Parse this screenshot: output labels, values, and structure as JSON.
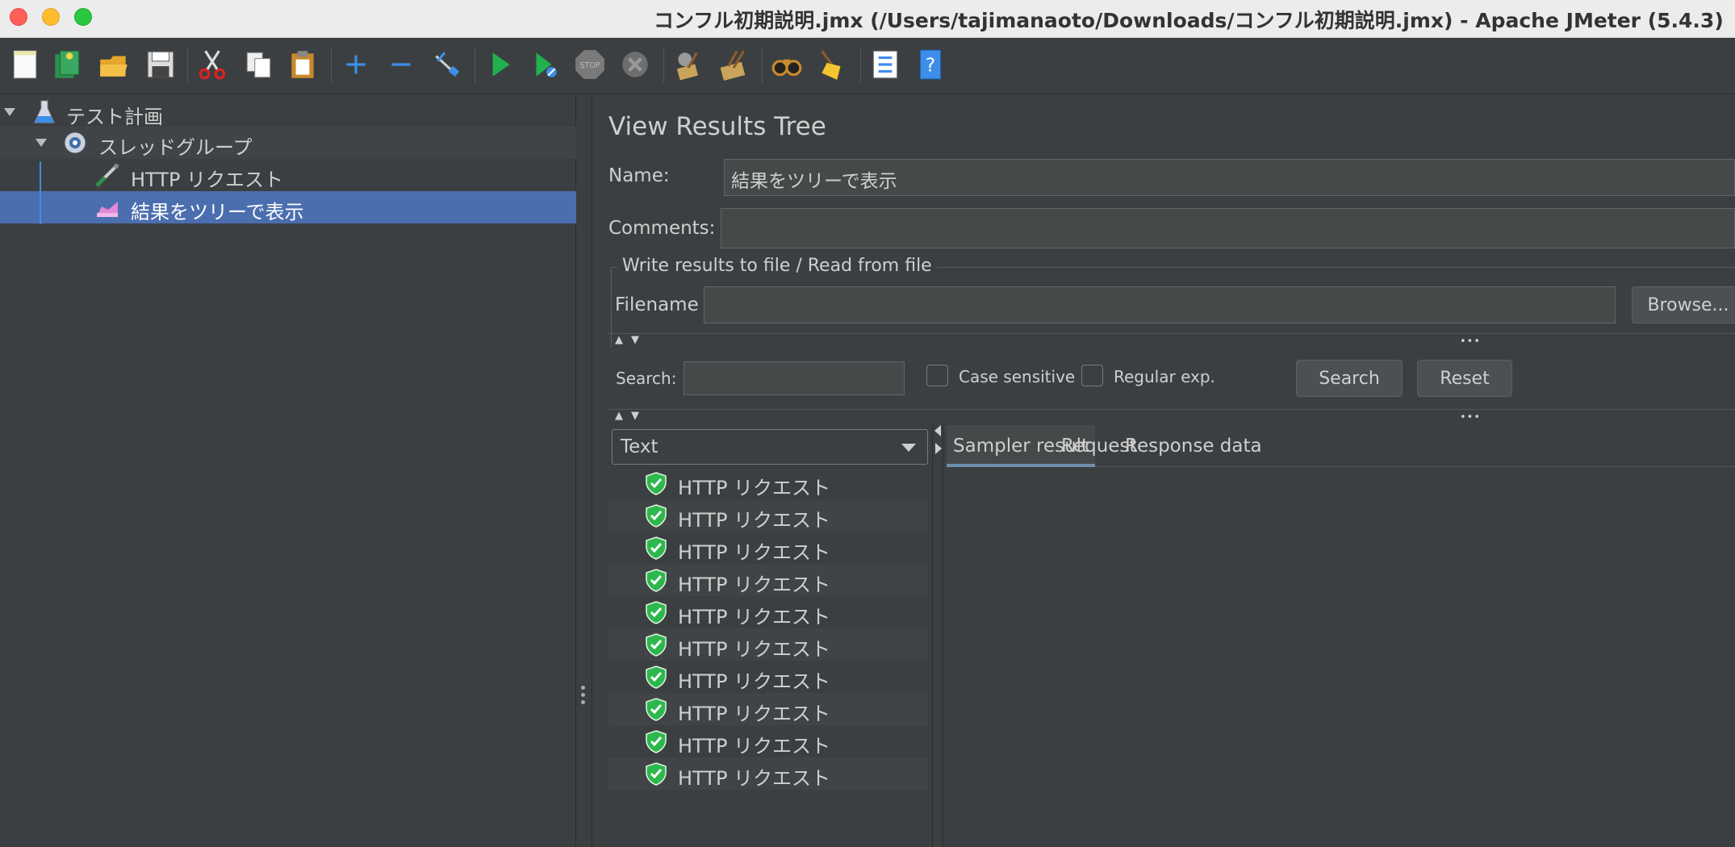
{
  "window": {
    "title": "コンフル初期説明.jmx (/Users/tajimanaoto/Downloads/コンフル初期説明.jmx) - Apache JMeter (5.4.3)"
  },
  "toolbar": {
    "buttons": [
      "new-icon",
      "templates-icon",
      "open-icon",
      "save-icon",
      "cut-icon",
      "copy-icon",
      "paste-icon",
      "expand-icon",
      "collapse-icon",
      "toggle-icon",
      "start-icon",
      "start-no-pauses-icon",
      "stop-icon",
      "shutdown-icon",
      "clear-icon",
      "clear-all-icon",
      "search-icon",
      "reset-search-icon",
      "function-helper-icon",
      "help-icon"
    ]
  },
  "tree": {
    "items": [
      {
        "label": "テスト計画",
        "icon": "test-plan-icon",
        "level": 0,
        "expanded": true
      },
      {
        "label": "スレッドグループ",
        "icon": "thread-group-icon",
        "level": 1,
        "expanded": true
      },
      {
        "label": "HTTP リクエスト",
        "icon": "http-sampler-icon",
        "level": 2
      },
      {
        "label": "結果をツリーで表示",
        "icon": "listener-icon",
        "level": 2,
        "selected": true
      }
    ]
  },
  "panel": {
    "title": "View Results Tree",
    "name_label": "Name:",
    "name_value": "結果をツリーで表示",
    "comments_label": "Comments:",
    "comments_value": "",
    "file_group_label": "Write results to file / Read from file",
    "filename_label": "Filename",
    "filename_value": "",
    "browse_label": "Browse...",
    "search_label": "Search:",
    "search_value": "",
    "case_sensitive_label": "Case sensitive",
    "case_sensitive_checked": false,
    "regex_label": "Regular exp.",
    "regex_checked": false,
    "search_button": "Search",
    "reset_button": "Reset",
    "renderer_selected": "Text",
    "results": [
      "HTTP リクエスト",
      "HTTP リクエスト",
      "HTTP リクエスト",
      "HTTP リクエスト",
      "HTTP リクエスト",
      "HTTP リクエスト",
      "HTTP リクエスト",
      "HTTP リクエスト",
      "HTTP リクエスト",
      "HTTP リクエスト"
    ],
    "tabs": [
      {
        "label": "Sampler result",
        "active": true
      },
      {
        "label": "Request",
        "active": false
      },
      {
        "label": "Response data",
        "active": false
      }
    ]
  },
  "colors": {
    "selection": "#4b6eaf",
    "success": "#2db84d",
    "background": "#3c3f41"
  }
}
